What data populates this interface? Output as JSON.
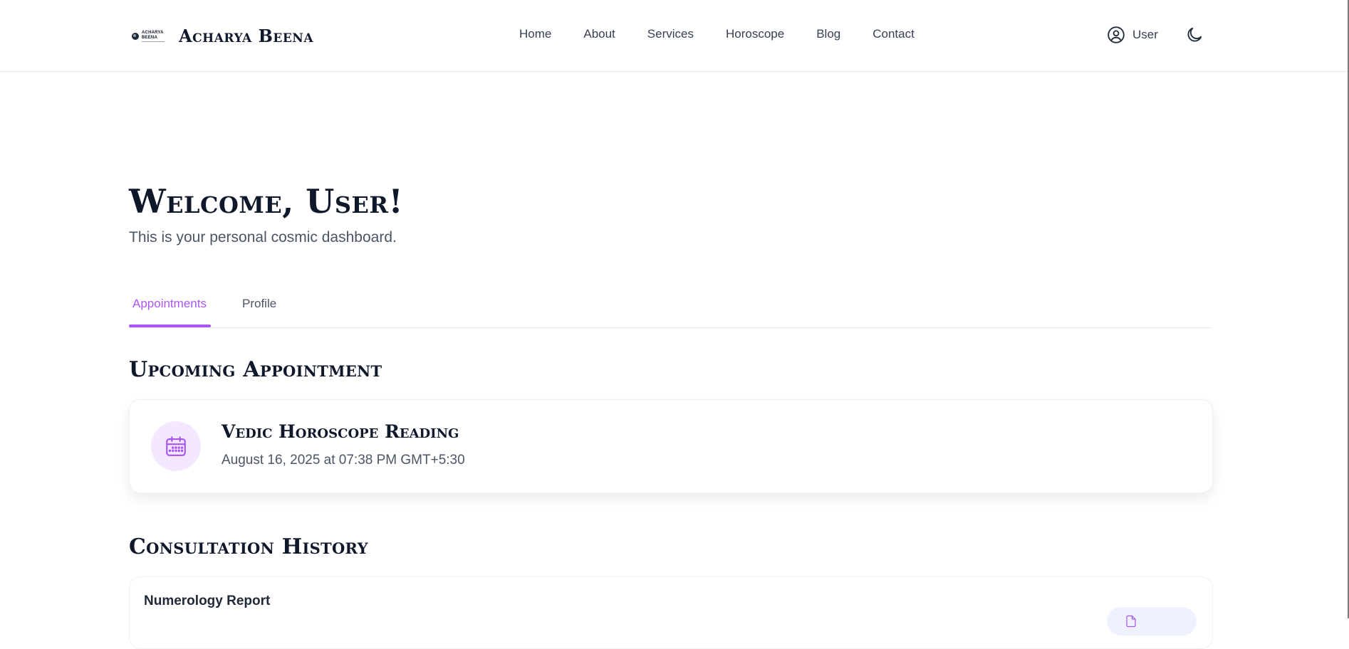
{
  "header": {
    "logo_text_line1": "ACHARYA",
    "logo_text_line2": "BEENA",
    "brand_name": "Acharya Beena",
    "nav": [
      {
        "label": "Home"
      },
      {
        "label": "About"
      },
      {
        "label": "Services"
      },
      {
        "label": "Horoscope"
      },
      {
        "label": "Blog"
      },
      {
        "label": "Contact"
      }
    ],
    "user_label": "User",
    "user_icon": "user-circle-icon",
    "theme_icon": "moon-icon"
  },
  "welcome": {
    "title": "Welcome, User!",
    "subtitle": "This is your personal cosmic dashboard."
  },
  "tabs": [
    {
      "label": "Appointments",
      "active": true
    },
    {
      "label": "Profile",
      "active": false
    }
  ],
  "upcoming": {
    "heading": "Upcoming Appointment",
    "icon": "calendar-icon",
    "title": "Vedic Horoscope Reading",
    "datetime": "August 16, 2025 at 07:38 PM GMT+5:30"
  },
  "history": {
    "heading": "Consultation History",
    "items": [
      {
        "title": "Numerology Report",
        "button_icon": "document-icon"
      }
    ]
  },
  "colors": {
    "accent": "#a855f7",
    "accent_light": "#f3e8ff",
    "text_dark": "#0f172a",
    "text_muted": "#4b5563"
  }
}
